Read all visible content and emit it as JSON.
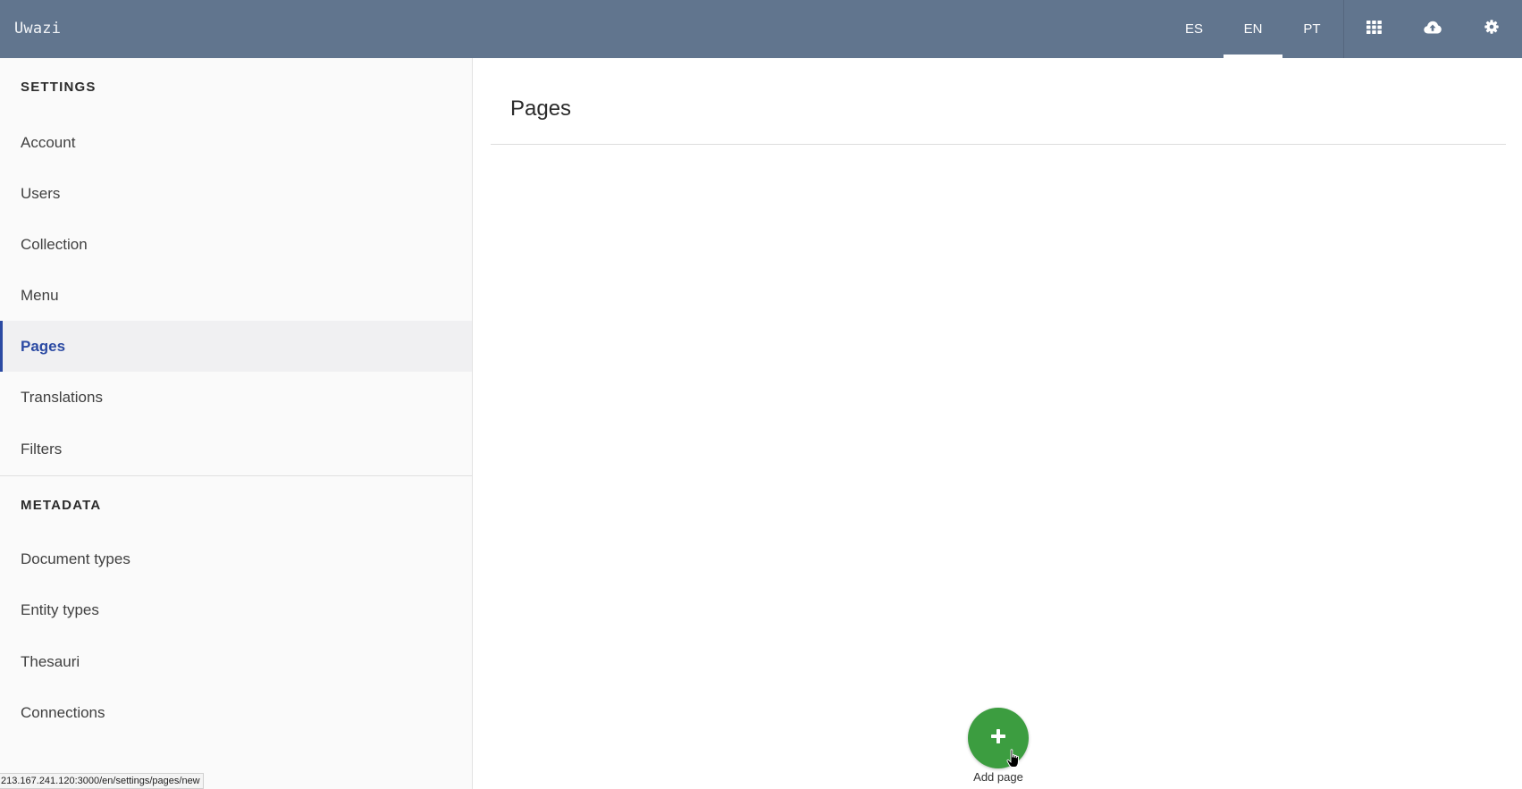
{
  "app": {
    "title": "Uwazi"
  },
  "topbar": {
    "languages": [
      {
        "label": "ES",
        "active": false
      },
      {
        "label": "EN",
        "active": true
      },
      {
        "label": "PT",
        "active": false
      }
    ],
    "icons": [
      "grid-icon",
      "cloud-upload-icon",
      "gear-icon"
    ],
    "background_color": "#61758e"
  },
  "sidebar": {
    "settings_header": "SETTINGS",
    "settings_items": [
      {
        "label": "Account"
      },
      {
        "label": "Users"
      },
      {
        "label": "Collection"
      },
      {
        "label": "Menu"
      },
      {
        "label": "Pages",
        "active": true
      },
      {
        "label": "Translations"
      },
      {
        "label": "Filters"
      }
    ],
    "metadata_header": "METADATA",
    "metadata_items": [
      {
        "label": "Document types"
      },
      {
        "label": "Entity types"
      },
      {
        "label": "Thesauri"
      },
      {
        "label": "Connections"
      }
    ],
    "active_color": "#2b4aa3"
  },
  "main": {
    "title": "Pages",
    "add_button": {
      "label": "Add page",
      "icon": "plus-icon",
      "color": "#3c9d40"
    }
  },
  "status_bar": {
    "url": "213.167.241.120:3000/en/settings/pages/new"
  }
}
